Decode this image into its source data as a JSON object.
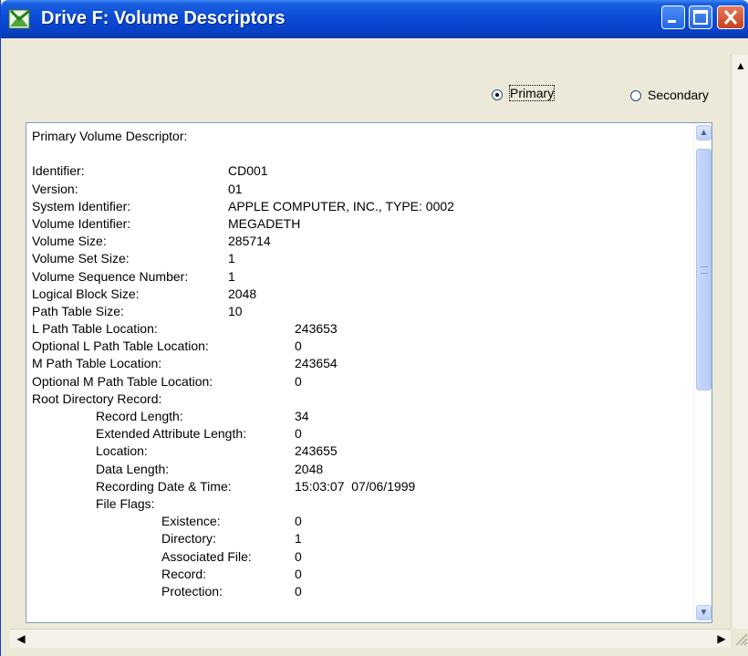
{
  "window": {
    "title": "Drive F: Volume Descriptors"
  },
  "radios": {
    "primary_label": "Primary",
    "secondary_label": "Secondary",
    "selected": "Primary"
  },
  "descriptor_lines": [
    {
      "label": "Primary Volume Descriptor:",
      "value": ""
    },
    {
      "label": "",
      "value": ""
    },
    {
      "label": "Identifier:",
      "value": "CD001"
    },
    {
      "label": "Version:",
      "value": "01"
    },
    {
      "label": "System Identifier:",
      "value": "APPLE COMPUTER, INC., TYPE: 0002"
    },
    {
      "label": "Volume Identifier:",
      "value": "MEGADETH"
    },
    {
      "label": "Volume Size:",
      "value": "285714"
    },
    {
      "label": "Volume Set Size:",
      "value": "1"
    },
    {
      "label": "Volume Sequence Number:",
      "value": "1"
    },
    {
      "label": "Logical Block Size:",
      "value": "2048"
    },
    {
      "label": "Path Table Size:",
      "value": "10"
    },
    {
      "label": "L Path Table Location:",
      "value": "243653"
    },
    {
      "label": "Optional L Path Table Location:",
      "value": "0"
    },
    {
      "label": "M Path Table Location:",
      "value": "243654"
    },
    {
      "label": "Optional M Path Table Location:",
      "value": "0"
    },
    {
      "label": "Root Directory Record:",
      "value": ""
    },
    {
      "label": "Record Length:",
      "value": "34"
    },
    {
      "label": "Extended Attribute Length:",
      "value": "0"
    },
    {
      "label": "Location:",
      "value": "243655"
    },
    {
      "label": "Data Length:",
      "value": "2048"
    },
    {
      "label": "Recording Date & Time:",
      "value": "15:03:07  07/06/1999"
    },
    {
      "label": "File Flags:",
      "value": ""
    },
    {
      "label": "Existence:",
      "value": "0"
    },
    {
      "label": "Directory:",
      "value": "1"
    },
    {
      "label": "Associated File:",
      "value": "0"
    },
    {
      "label": "Record:",
      "value": "0"
    },
    {
      "label": "Protection:",
      "value": "0"
    }
  ],
  "icons": {
    "title": "drive-window-icon",
    "minimize": "minimize-icon",
    "maximize": "maximize-icon",
    "close": "close-icon"
  },
  "colors": {
    "titlebar": "#0a4bd6",
    "close_button": "#c8401c",
    "window_bg": "#ece9d8"
  }
}
